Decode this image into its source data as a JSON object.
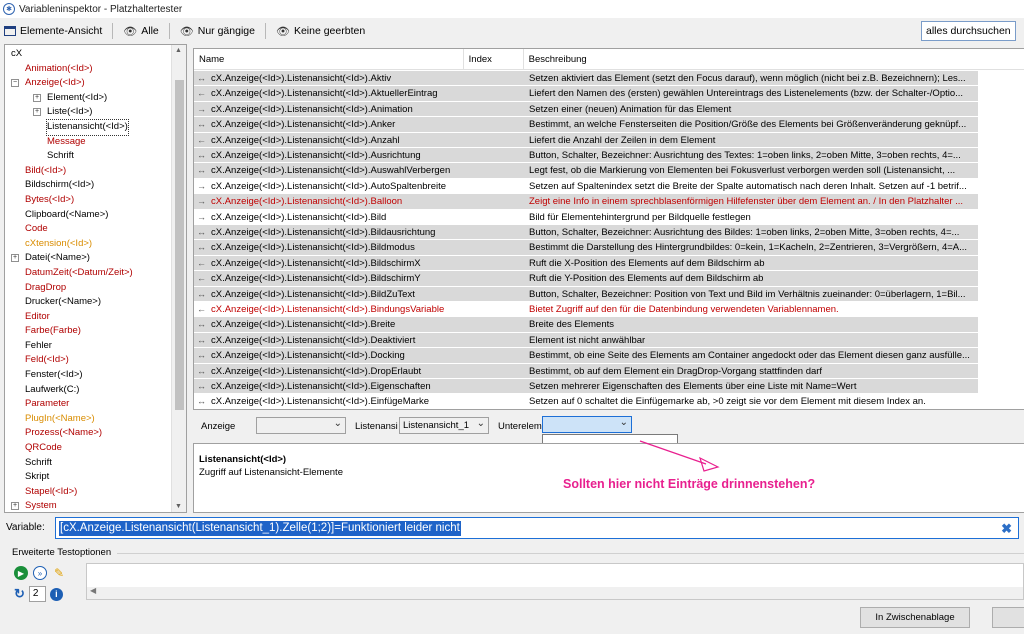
{
  "window": {
    "title": "Variableninspektor - Platzhaltertester"
  },
  "toolbar": {
    "view_label": "Elemente-Ansicht",
    "filter_all": "Alle",
    "filter_common": "Nur gängige",
    "filter_no_inherited": "Keine geerbten",
    "search_button": "alles durchsuchen"
  },
  "tree": {
    "items": [
      {
        "label": "cX",
        "color": "dark"
      },
      {
        "label": "Animation(<Id>)",
        "color": "red"
      },
      {
        "label": "Anzeige(<Id>)",
        "color": "red"
      },
      {
        "label": "Element(<Id>)",
        "color": "dark"
      },
      {
        "label": "Liste(<Id>)",
        "color": "dark"
      },
      {
        "label": "Listenansicht(<Id>)",
        "color": "dark"
      },
      {
        "label": "Message",
        "color": "red"
      },
      {
        "label": "Schrift",
        "color": "dark"
      },
      {
        "label": "Bild(<Id>)",
        "color": "red"
      },
      {
        "label": "Bildschirm(<Id>)",
        "color": "dark"
      },
      {
        "label": "Bytes(<Id>)",
        "color": "red"
      },
      {
        "label": "Clipboard(<Name>)",
        "color": "dark"
      },
      {
        "label": "Code",
        "color": "red"
      },
      {
        "label": "cXtension(<Id>)",
        "color": "orange"
      },
      {
        "label": "Datei(<Name>)",
        "color": "dark"
      },
      {
        "label": "DatumZeit(<Datum/Zeit>)",
        "color": "red"
      },
      {
        "label": "DragDrop",
        "color": "red"
      },
      {
        "label": "Drucker(<Name>)",
        "color": "dark"
      },
      {
        "label": "Editor",
        "color": "red"
      },
      {
        "label": "Farbe(Farbe)",
        "color": "red"
      },
      {
        "label": "Fehler",
        "color": "dark"
      },
      {
        "label": "Feld(<Id>)",
        "color": "red"
      },
      {
        "label": "Fenster(<Id>)",
        "color": "dark"
      },
      {
        "label": "Laufwerk(C:)",
        "color": "dark"
      },
      {
        "label": "Parameter",
        "color": "red"
      },
      {
        "label": "PlugIn(<Name>)",
        "color": "orange"
      },
      {
        "label": "Prozess(<Name>)",
        "color": "red"
      },
      {
        "label": "QRCode",
        "color": "red"
      },
      {
        "label": "Schrift",
        "color": "dark"
      },
      {
        "label": "Skript",
        "color": "dark"
      },
      {
        "label": "Stapel(<Id>)",
        "color": "red"
      },
      {
        "label": "System",
        "color": "red"
      }
    ]
  },
  "grid": {
    "headers": {
      "name": "Name",
      "index": "Index",
      "description": "Beschreibung"
    },
    "rows": [
      {
        "name": "cX.Anzeige(<Id>).Listenansicht(<Id>).Aktiv",
        "arrow": "↔",
        "desc": "Setzen aktiviert das Element (setzt den Focus darauf), wenn möglich (nicht bei z.B. Bezeichnern); Les...",
        "style": "gray"
      },
      {
        "name": "cX.Anzeige(<Id>).Listenansicht(<Id>).AktuellerEintrag",
        "arrow": "←",
        "desc": "Liefert den Namen des (ersten) gewählen Untereintrags des Listenelements (bzw. der Schalter-/Optio...",
        "style": "gray"
      },
      {
        "name": "cX.Anzeige(<Id>).Listenansicht(<Id>).Animation",
        "arrow": "→",
        "desc": "Setzen einer (neuen) Animation für das Element",
        "style": "gray"
      },
      {
        "name": "cX.Anzeige(<Id>).Listenansicht(<Id>).Anker",
        "arrow": "↔",
        "desc": "Bestimmt, an welche Fensterseiten die Position/Größe des Elements bei Größenveränderung geknüpf...",
        "style": "gray"
      },
      {
        "name": "cX.Anzeige(<Id>).Listenansicht(<Id>).Anzahl",
        "arrow": "←",
        "desc": "Liefert die Anzahl der Zeilen in dem Element",
        "style": "gray"
      },
      {
        "name": "cX.Anzeige(<Id>).Listenansicht(<Id>).Ausrichtung",
        "arrow": "↔",
        "desc": "Button, Schalter, Bezeichner: Ausrichtung des Textes: 1=oben links, 2=oben Mitte, 3=oben rechts, 4=...",
        "style": "gray"
      },
      {
        "name": "cX.Anzeige(<Id>).Listenansicht(<Id>).AuswahlVerbergen",
        "arrow": "↔",
        "desc": "Legt fest, ob die Markierung von Elementen bei Fokusverlust verborgen werden soll (Listenansicht, ...",
        "style": "gray"
      },
      {
        "name": "cX.Anzeige(<Id>).Listenansicht(<Id>).AutoSpaltenbreite",
        "arrow": "→",
        "desc": "Setzen auf Spaltenindex setzt die Breite der Spalte automatisch nach deren Inhalt. Setzen auf -1 betrif...",
        "style": "white"
      },
      {
        "name": "cX.Anzeige(<Id>).Listenansicht(<Id>).Balloon",
        "arrow": "→",
        "desc": "Zeigt eine Info in einem sprechblasenförmigen Hilfefenster über dem Element an. / In den Platzhalter ...",
        "style": "gray red"
      },
      {
        "name": "cX.Anzeige(<Id>).Listenansicht(<Id>).Bild",
        "arrow": "→",
        "desc": "Bild für Elementehintergrund per Bildquelle festlegen",
        "style": "white"
      },
      {
        "name": "cX.Anzeige(<Id>).Listenansicht(<Id>).Bildausrichtung",
        "arrow": "↔",
        "desc": "Button, Schalter, Bezeichner: Ausrichtung des Bildes: 1=oben links, 2=oben Mitte, 3=oben rechts, 4=...",
        "style": "gray"
      },
      {
        "name": "cX.Anzeige(<Id>).Listenansicht(<Id>).Bildmodus",
        "arrow": "↔",
        "desc": "Bestimmt die Darstellung des Hintergrundbildes: 0=kein, 1=Kacheln, 2=Zentrieren, 3=Vergrößern, 4=A...",
        "style": "gray"
      },
      {
        "name": "cX.Anzeige(<Id>).Listenansicht(<Id>).BildschirmX",
        "arrow": "←",
        "desc": "Ruft die X-Position des Elements auf dem Bildschirm ab",
        "style": "gray"
      },
      {
        "name": "cX.Anzeige(<Id>).Listenansicht(<Id>).BildschirmY",
        "arrow": "←",
        "desc": "Ruft die Y-Position des Elements auf dem Bildschirm ab",
        "style": "gray"
      },
      {
        "name": "cX.Anzeige(<Id>).Listenansicht(<Id>).BildZuText",
        "arrow": "↔",
        "desc": "Button, Schalter, Bezeichner: Position von Text und Bild im Verhältnis zueinander: 0=überlagern, 1=Bil...",
        "style": "gray"
      },
      {
        "name": "cX.Anzeige(<Id>).Listenansicht(<Id>).BindungsVariable",
        "arrow": "←",
        "desc": "Bietet Zugriff auf den für die Datenbindung verwendeten Variablennamen.",
        "style": "white red"
      },
      {
        "name": "cX.Anzeige(<Id>).Listenansicht(<Id>).Breite",
        "arrow": "↔",
        "desc": "Breite des Elements",
        "style": "gray"
      },
      {
        "name": "cX.Anzeige(<Id>).Listenansicht(<Id>).Deaktiviert",
        "arrow": "↔",
        "desc": "Element ist nicht anwählbar",
        "style": "gray"
      },
      {
        "name": "cX.Anzeige(<Id>).Listenansicht(<Id>).Docking",
        "arrow": "↔",
        "desc": "Bestimmt, ob eine Seite des Elements am Container angedockt oder das Element diesen ganz ausfülle...",
        "style": "gray"
      },
      {
        "name": "cX.Anzeige(<Id>).Listenansicht(<Id>).DropErlaubt",
        "arrow": "↔",
        "desc": "Bestimmt, ob auf dem Element ein DragDrop-Vorgang stattfinden darf",
        "style": "gray"
      },
      {
        "name": "cX.Anzeige(<Id>).Listenansicht(<Id>).Eigenschaften",
        "arrow": "↔",
        "desc": "Setzen mehrerer Eigenschaften des Elements über eine Liste mit Name=Wert",
        "style": "gray"
      },
      {
        "name": "cX.Anzeige(<Id>).Listenansicht(<Id>).EinfügeMarke",
        "arrow": "↔",
        "desc": "Setzen auf 0 schaltet die Einfügemarke ab, >0 zeigt sie vor dem Element mit diesem Index an.",
        "style": "white"
      }
    ]
  },
  "filter": {
    "anzeige_label": "Anzeige",
    "anzeige_value": "",
    "listen_label": "Listenansi",
    "listen_value": "Listenansicht_1",
    "unter_label": "Unterelem",
    "unter_value": ""
  },
  "info": {
    "title": "Listenansicht(<Id>)",
    "description": "Zugriff auf Listenansicht-Elemente"
  },
  "annotation": {
    "text": "Sollten hier nicht Einträge drinnenstehen?"
  },
  "variable": {
    "label": "Variable:",
    "value": "[cX.Anzeige.Listenansicht(Listenansicht_1).Zelle(1;2)]=Funktioniert leider nicht"
  },
  "extended": {
    "label": "Erweiterte Testoptionen",
    "repeat_count": "2"
  },
  "buttons": {
    "clipboard": "In Zwischenablage"
  },
  "colors": {
    "row_gray": "#d9d9d9",
    "red_text": "#c00000",
    "annotation": "#e8208f",
    "selection": "#1e63c8"
  }
}
